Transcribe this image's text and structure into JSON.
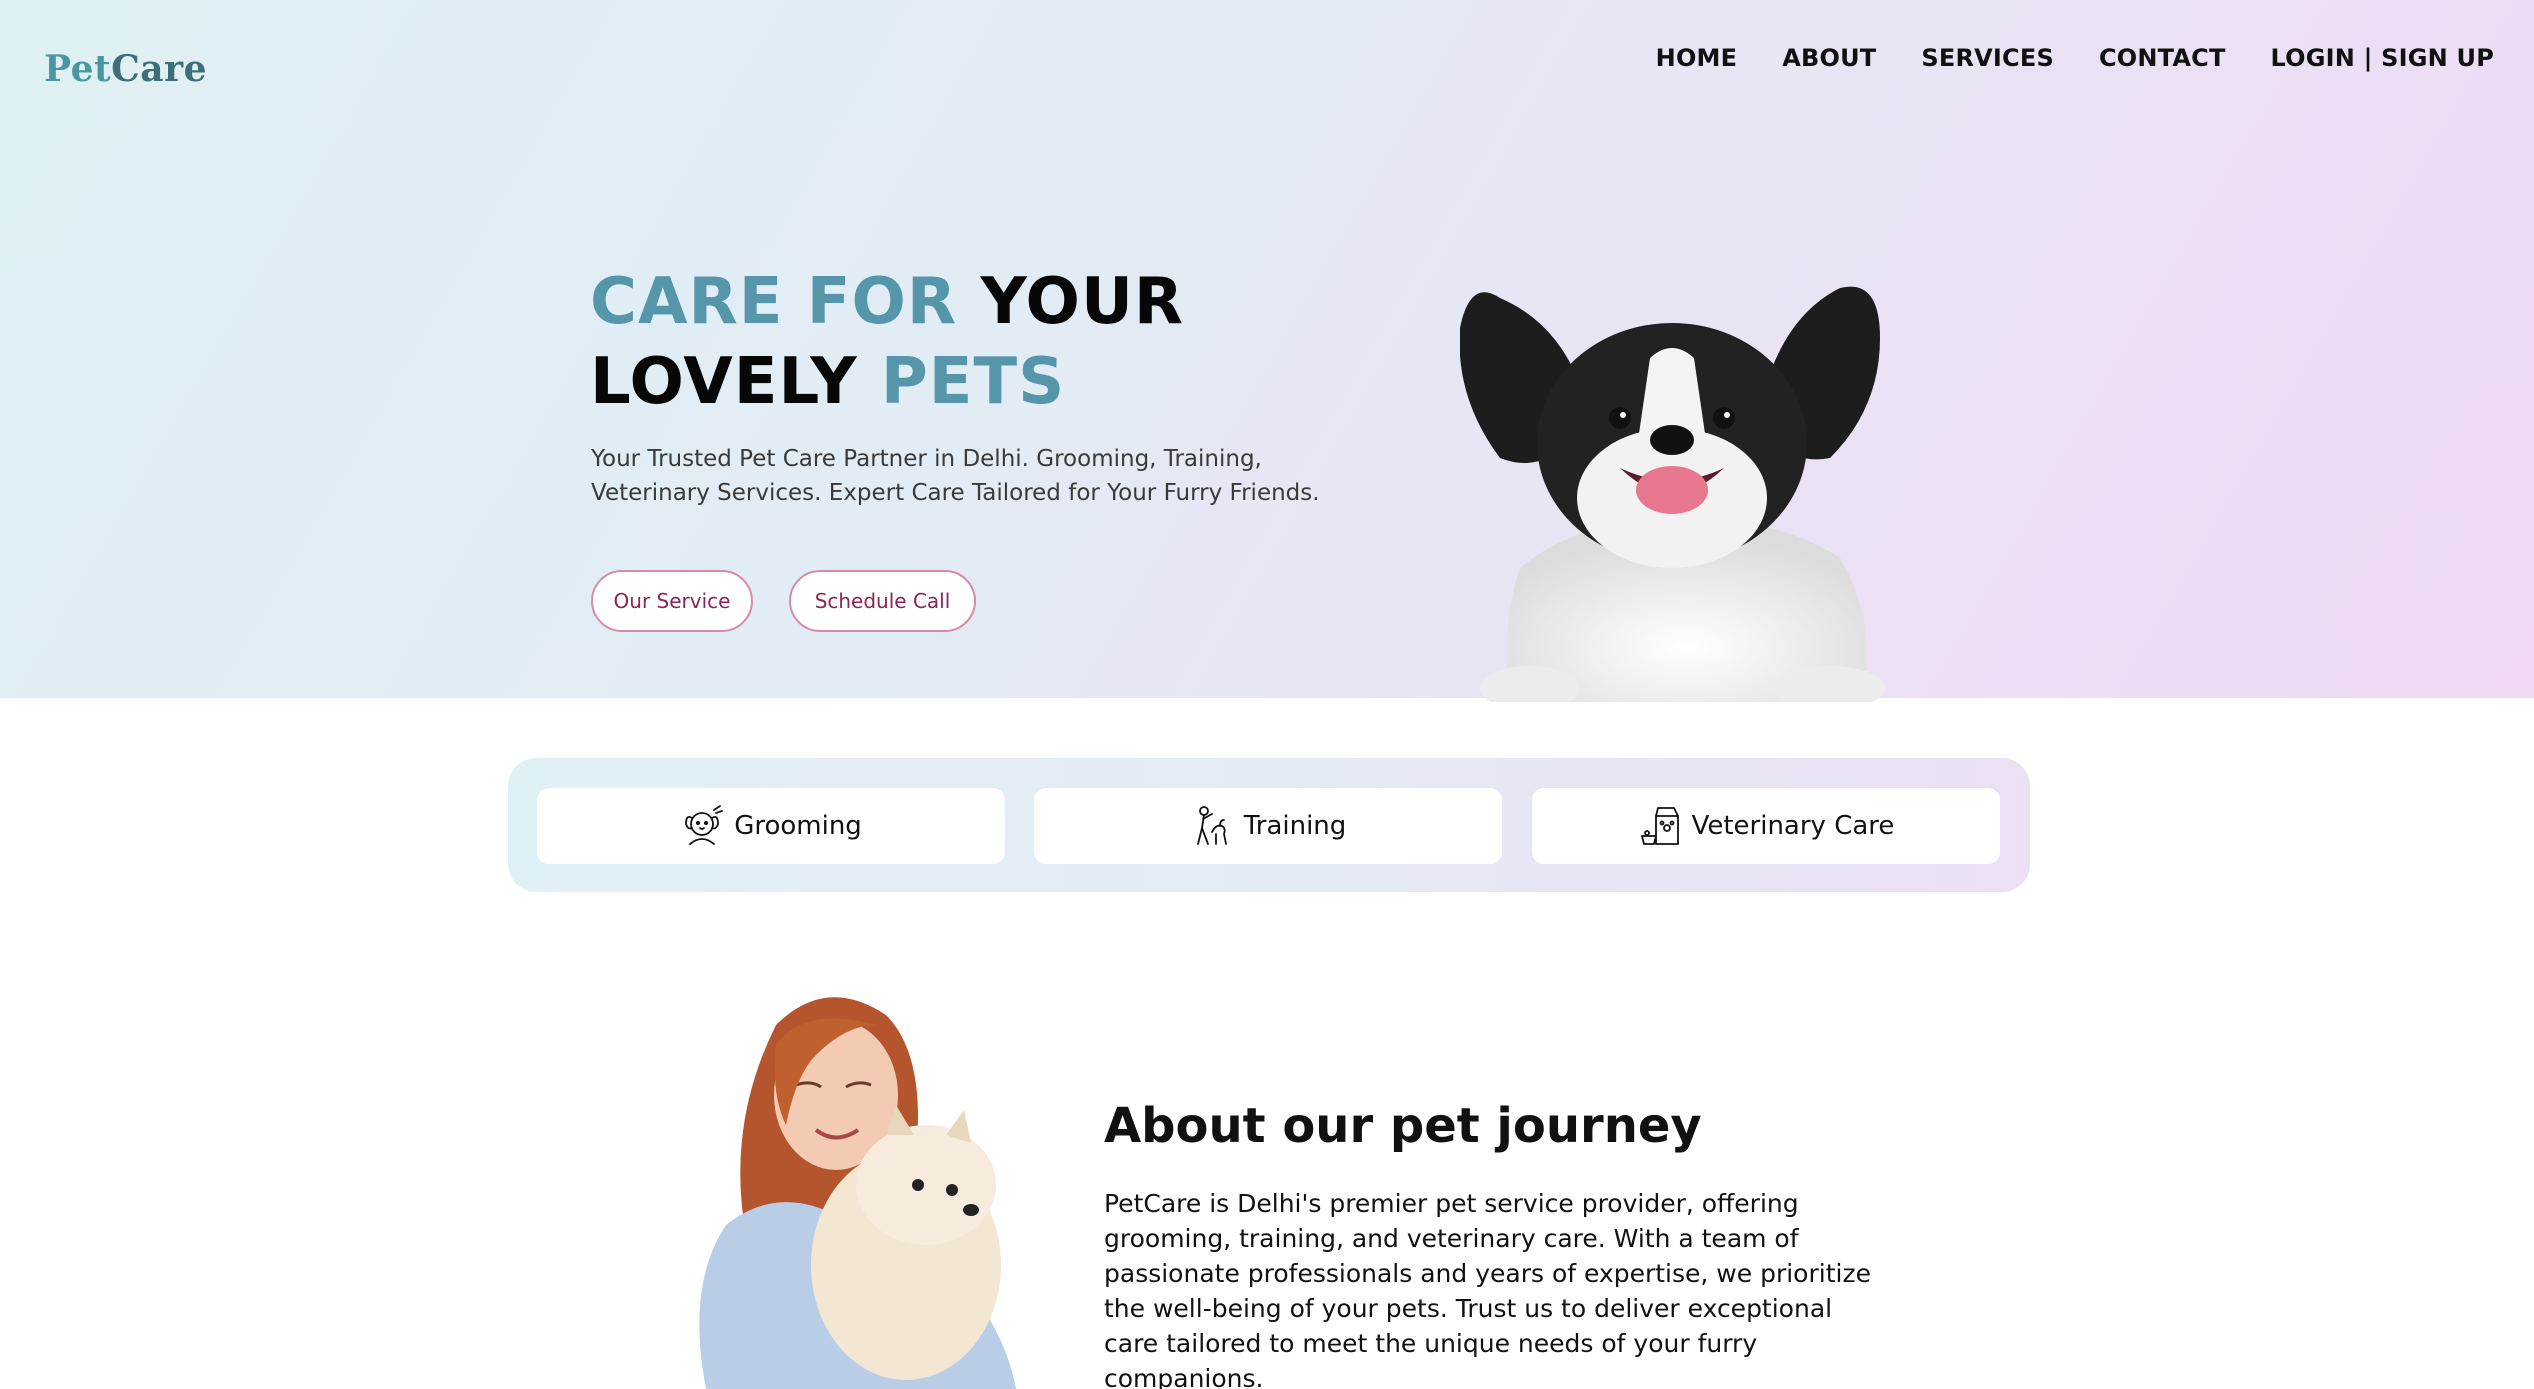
{
  "brand": {
    "part1": "Pet",
    "part2": "Care",
    "color": "#4a97a3"
  },
  "nav": {
    "items": [
      "HOME",
      "ABOUT",
      "SERVICES",
      "CONTACT",
      "LOGIN | SIGN UP"
    ]
  },
  "hero": {
    "headline": {
      "w1": "CARE FOR",
      "w2": "YOUR",
      "w3": "LOVELY",
      "w4": "PETS"
    },
    "tagline": "Your Trusted Pet Care Partner in Delhi. Grooming, Training, Veterinary Services. Expert Care Tailored for Your Furry Friends.",
    "buttons": {
      "service": "Our Service",
      "call": "Schedule Call"
    },
    "accent_color": "#5596ab",
    "button_text_color": "#8e2454"
  },
  "services": [
    {
      "label": "Grooming",
      "icon": "dog-grooming-icon"
    },
    {
      "label": "Training",
      "icon": "dog-training-icon"
    },
    {
      "label": "Veterinary Care",
      "icon": "pet-food-icon"
    }
  ],
  "about": {
    "title": "About our pet journey",
    "text": "PetCare is Delhi's premier pet service provider, offering grooming, training, and veterinary care. With a team of passionate professionals and years of expertise, we prioritize the well-being of your pets. Trust us to deliver exceptional care tailored to meet the unique needs of your furry companions."
  }
}
